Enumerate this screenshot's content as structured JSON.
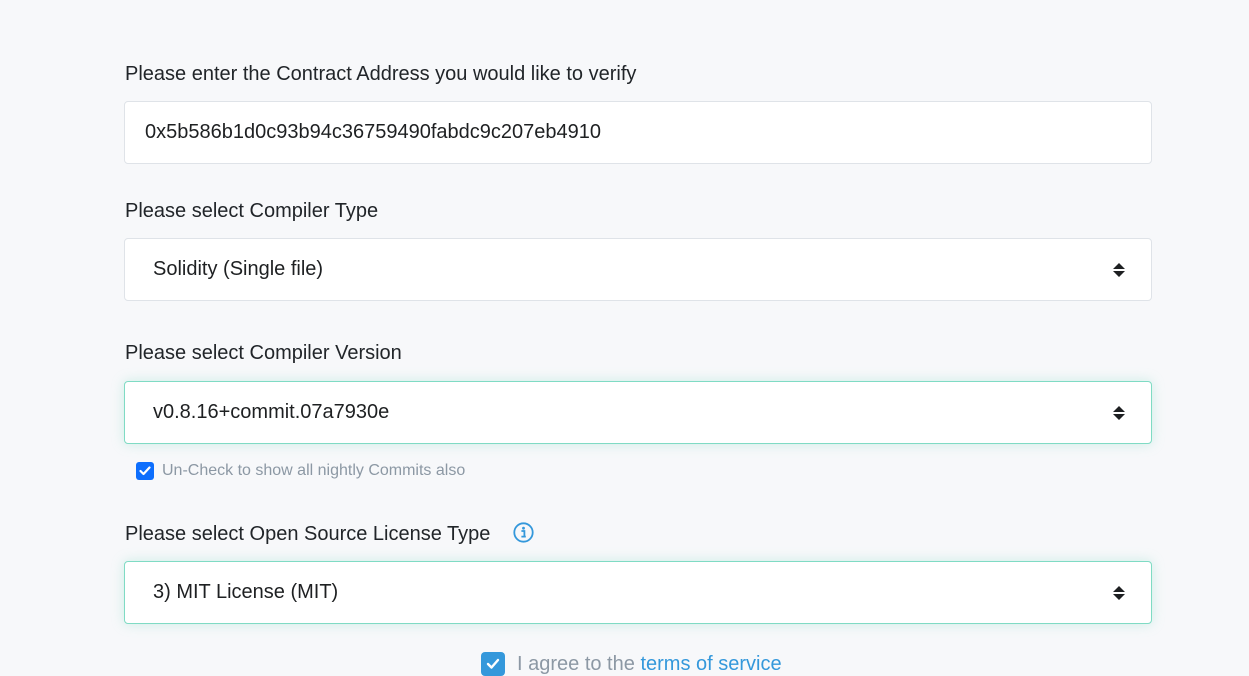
{
  "contract_address": {
    "label": "Please enter the Contract Address you would like to verify",
    "value": "0x5b586b1d0c93b94c36759490fabdc9c207eb4910"
  },
  "compiler_type": {
    "label": "Please select Compiler Type",
    "selected": "Solidity (Single file)"
  },
  "compiler_version": {
    "label": "Please select Compiler Version",
    "selected": "v0.8.16+commit.07a7930e",
    "nightly_checkbox": {
      "checked": true,
      "label": "Un-Check to show all nightly Commits also"
    }
  },
  "license_type": {
    "label": "Please select Open Source License Type",
    "info_icon": "info-circle-icon",
    "selected": "3) MIT License (MIT)"
  },
  "agreement": {
    "checked": true,
    "prefix": "I agree to the",
    "link_text": "terms of service"
  },
  "colors": {
    "accent": "#3498db",
    "checkbox": "#0d6efd",
    "focus_border": "#7fdbc4",
    "muted_text": "#8c98a4",
    "background": "#f7f8fa"
  }
}
